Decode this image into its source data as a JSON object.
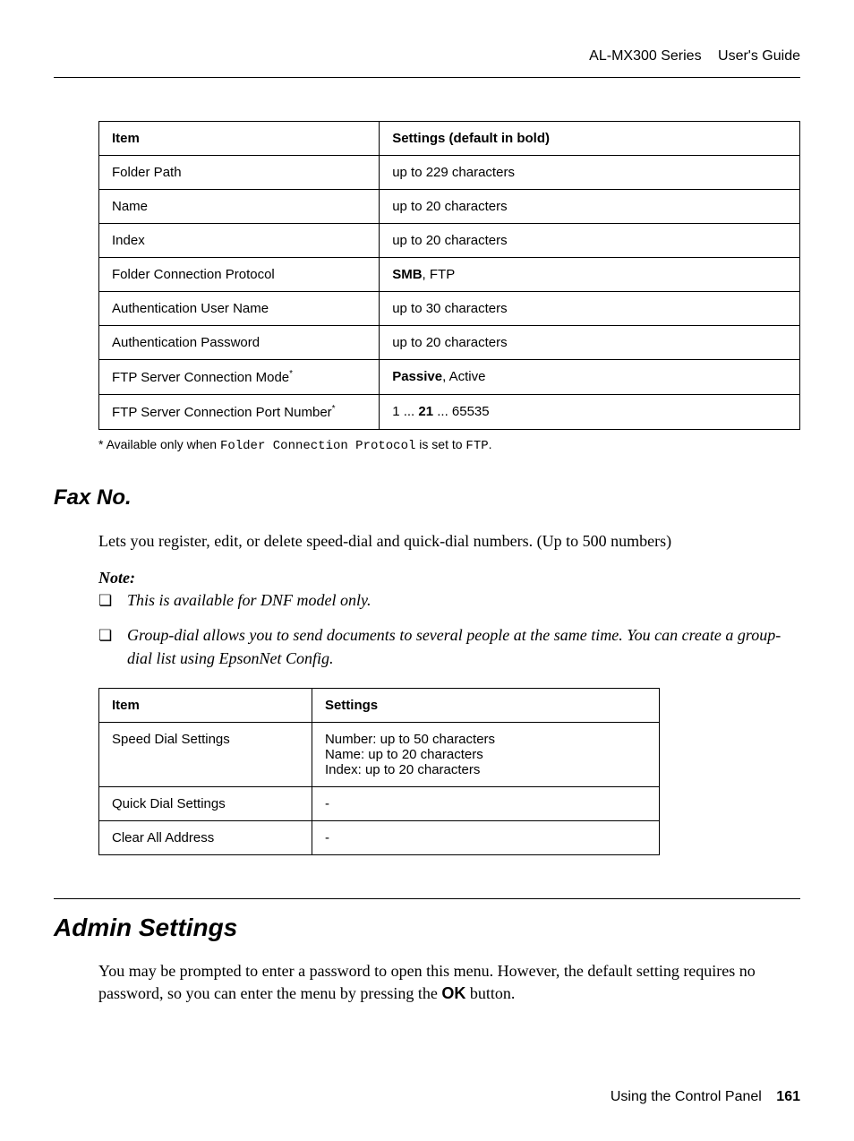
{
  "header": {
    "series": "AL-MX300 Series",
    "guide": "User's Guide"
  },
  "table1": {
    "headers": [
      "Item",
      "Settings (default in bold)"
    ],
    "rows": [
      {
        "item": "Folder Path",
        "settings": "up to 229 characters"
      },
      {
        "item": "Name",
        "settings": "up to 20 characters"
      },
      {
        "item": "Index",
        "settings": "up to 20 characters"
      },
      {
        "item": "Folder Connection Protocol",
        "settings_bold": "SMB",
        "settings_rest": ", FTP"
      },
      {
        "item": "Authentication User Name",
        "settings": "up to 30 characters"
      },
      {
        "item": "Authentication Password",
        "settings": "up to 20 characters"
      },
      {
        "item": "FTP Server Connection Mode",
        "item_sup": "*",
        "settings_bold": "Passive",
        "settings_rest": ", Active"
      },
      {
        "item": "FTP Server Connection Port Number",
        "item_sup": "*",
        "settings_pre": "1 ... ",
        "settings_bold": "21",
        "settings_rest": " ... 65535"
      }
    ]
  },
  "footnote": {
    "prefix": "*  Available only when ",
    "mono1": "Folder Connection Protocol",
    "mid": " is set to ",
    "mono2": "FTP",
    "suffix": "."
  },
  "fax": {
    "title": "Fax No.",
    "body": "Lets you register, edit, or delete speed-dial and quick-dial numbers. (Up to 500 numbers)",
    "note_label": "Note:",
    "notes": [
      "This is available for DNF model only.",
      "Group-dial allows you to send documents to several people at the same time. You can create a group-dial list using EpsonNet Config."
    ]
  },
  "table2": {
    "headers": [
      "Item",
      "Settings"
    ],
    "rows": [
      {
        "item": "Speed Dial Settings",
        "settings": "Number: up to 50 characters\nName: up to 20 characters\nIndex: up to 20 characters"
      },
      {
        "item": "Quick Dial Settings",
        "settings": "-"
      },
      {
        "item": "Clear All Address",
        "settings": "-"
      }
    ]
  },
  "admin": {
    "title": "Admin Settings",
    "body_pre": "You may be prompted to enter a password to open this menu. However, the default setting requires no password, so you can enter the menu by pressing the ",
    "body_bold": "OK",
    "body_post": " button."
  },
  "footer": {
    "chapter": "Using the Control Panel",
    "page": "161"
  }
}
